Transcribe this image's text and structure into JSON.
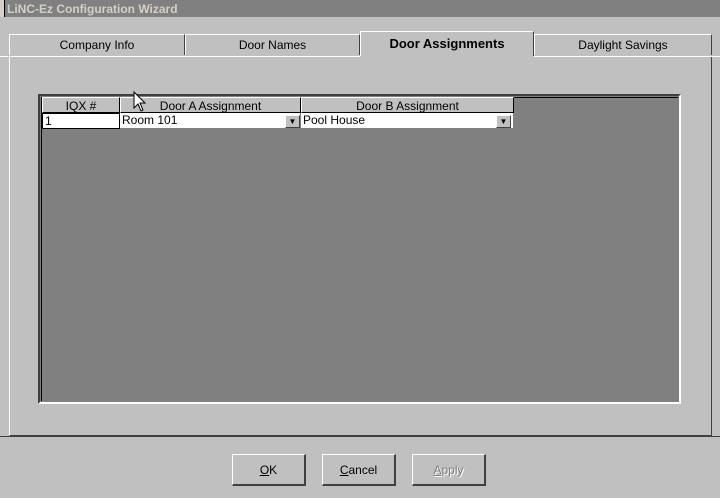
{
  "window": {
    "title": "LiNC-Ez Configuration Wizard"
  },
  "tabs": [
    {
      "label": "Company Info",
      "active": false
    },
    {
      "label": "Door Names",
      "active": false
    },
    {
      "label": "Door Assignments",
      "active": true
    },
    {
      "label": "Daylight Savings",
      "active": false
    }
  ],
  "grid": {
    "headers": [
      "IQX #",
      "Door A Assignment",
      "Door B Assignment"
    ],
    "rows": [
      {
        "iqx": "1",
        "door_a": "Room 101",
        "door_b": "Pool House"
      }
    ]
  },
  "buttons": {
    "ok": {
      "accel": "O",
      "rest": "K"
    },
    "cancel": {
      "accel": "C",
      "rest": "ancel"
    },
    "apply": {
      "accel": "A",
      "rest": "pply",
      "disabled": true
    }
  },
  "icons": {
    "dropdown": "chevron-down-icon",
    "cursor": "mouse-pointer-icon"
  }
}
